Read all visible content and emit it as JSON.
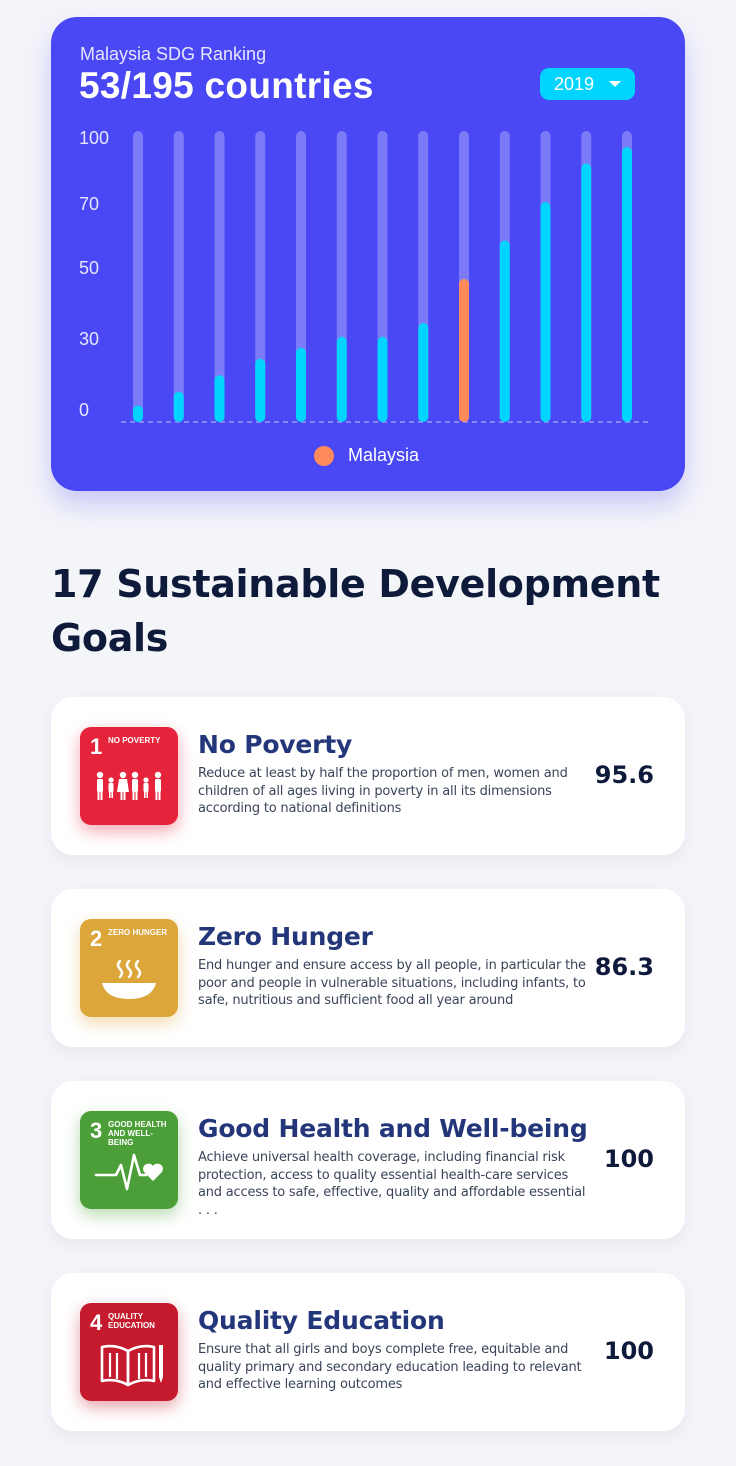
{
  "ranking": {
    "label": "Malaysia SDG Ranking",
    "headline": "53/195 countries",
    "year": "2019"
  },
  "chart_data": {
    "type": "bar",
    "ylim": [
      0,
      100
    ],
    "y_ticks": [
      "100",
      "70",
      "50",
      "30",
      "0"
    ],
    "grid": false,
    "legend": "bottom-center",
    "series": [
      {
        "name": "Malaysia",
        "values": [
          6,
          11,
          17,
          23,
          27,
          31,
          31,
          36,
          52,
          66,
          80,
          94,
          100
        ]
      }
    ],
    "highlight_index": 8,
    "colors": {
      "track": "#7c7bf7",
      "bar": "#00d4ff",
      "highlight": "#ff8a5c"
    }
  },
  "legend": {
    "label": "Malaysia"
  },
  "section": {
    "title": "17 Sustainable Development Goals"
  },
  "goals": [
    {
      "num": "1",
      "icon_label": "NO POVERTY",
      "icon": "family-icon",
      "color": "#e5243b",
      "title": "No Poverty",
      "desc": "Reduce at least by half the proportion of men, women and children of all ages living in poverty in all its dimensions according to national definitions",
      "score": "95.6"
    },
    {
      "num": "2",
      "icon_label": "ZERO HUNGER",
      "icon": "bowl-icon",
      "color": "#dda63a",
      "title": "Zero Hunger",
      "desc": "End hunger and ensure access by all people, in particular the poor and people in vulnerable situations, including infants, to safe, nutritious and sufficient food all year around",
      "score": "86.3"
    },
    {
      "num": "3",
      "icon_label": "GOOD HEALTH AND WELL-BEING",
      "icon": "heartbeat-icon",
      "color": "#4c9f38",
      "title": "Good Health and Well-being",
      "desc": "Achieve universal health coverage, including financial risk protection, access to quality essential health-care services and access to safe, effective, quality and affordable essential . . .",
      "score": "100"
    },
    {
      "num": "4",
      "icon_label": "QUALITY EDUCATION",
      "icon": "book-icon",
      "color": "#c5192d",
      "title": "Quality Education",
      "desc": "Ensure that all girls and boys complete free, equitable and quality primary and secondary education leading to relevant and effective learning outcomes",
      "score": "100"
    }
  ]
}
